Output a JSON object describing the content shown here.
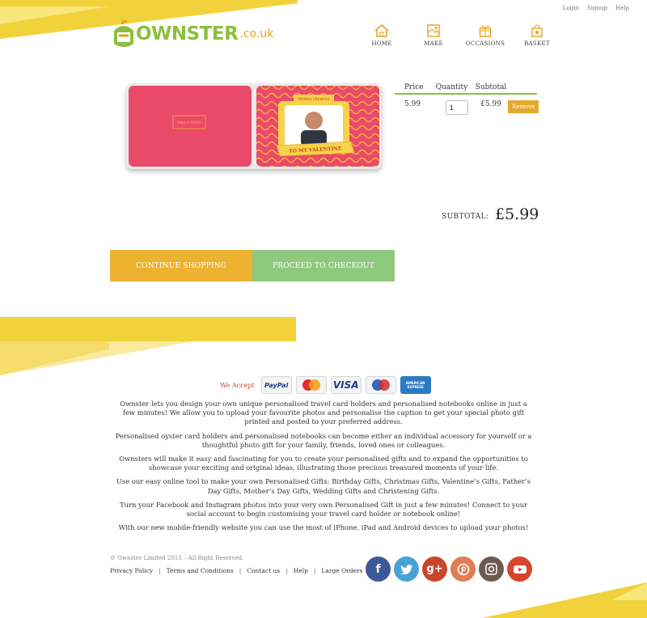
{
  "toplinks": {
    "login": "Login",
    "signup": "Signup",
    "help": "Help"
  },
  "logo": {
    "word": "OWNSTER",
    "tld": ".co.uk"
  },
  "nav": [
    {
      "label": "HOME",
      "icon": "home-icon"
    },
    {
      "label": "MAKE",
      "icon": "make-icon"
    },
    {
      "label": "OCCASIONS",
      "icon": "gift-icon"
    },
    {
      "label": "BASKET",
      "icon": "basket-icon"
    }
  ],
  "product": {
    "name_banner": "Dmitry Ulyanov",
    "caption": "TO MY VALENTINE",
    "inner_text": "Make it YOURS"
  },
  "cart": {
    "headers": {
      "price": "Price",
      "quantity": "Quantity",
      "subtotal": "Subtotal"
    },
    "row": {
      "price": "5.99",
      "quantity": "1",
      "subtotal": "£5.99",
      "remove": "Remove"
    }
  },
  "totals": {
    "label": "SUBTOTAL:",
    "value": "£5.99"
  },
  "buttons": {
    "continue": "CONTINUE SHOPPING",
    "checkout": "PROCEED TO CHECKOUT"
  },
  "payment": {
    "label": "We Accept",
    "methods": [
      "PayPal",
      "MasterCard",
      "VISA",
      "Maestro",
      "AMERICAN EXPRESS"
    ]
  },
  "about": [
    "Ownster lets you design your own unique personalised travel card holders and personalised notebooks online in just a few minutes! We allow you to upload your favourite photos and personalise the caption to get your special photo gift printed and posted to your preferred address.",
    "Personalised oyster card holders and personalised notebooks can become either an individual accessory for yourself or a thoughtful photo gift for your family, friends, loved ones or colleagues.",
    "Ownsters will make it easy and fascinating for you to create your personalised gifts and to expand the opportunities to showcase your exciting and original ideas, illustrating those precious treasured moments of your life.",
    "Use our easy online tool to make your own Personalised Gifts: Birthday Gifts, Christmas Gifts, Valentine’s Gifts, Father’s Day Gifts, Mother’s Day Gifts, Wedding Gifts and Christening Gifts.",
    "Turn your Facebook and Instagram photos into your very own Personalised Gift in just a few minutes! Connect to your social account to begin customising your travel card holder or notebook online!",
    "With our new mobile-friendly website you can use the most of iPhone, iPad and Android devices to upload your photos!"
  ],
  "footer": {
    "copyright": "© Ownster Limited 2015 – All Right Reserved.",
    "links": [
      "Privacy Policy",
      "Terms and Conditions",
      "Contact us",
      "Help",
      "Large Orders"
    ]
  },
  "social": [
    {
      "icon": "facebook-icon",
      "glyph": "f",
      "color": "#3b5998"
    },
    {
      "icon": "twitter-icon",
      "glyph": "t",
      "color": "#4aa1d8"
    },
    {
      "icon": "googleplus-icon",
      "glyph": "g+",
      "color": "#c9462d"
    },
    {
      "icon": "pinterest-icon",
      "glyph": "p",
      "color": "#e17c55"
    },
    {
      "icon": "instagram-icon",
      "glyph": "◙",
      "color": "#6d5a4e"
    },
    {
      "icon": "youtube-icon",
      "glyph": "▶",
      "color": "#d6452e"
    }
  ]
}
